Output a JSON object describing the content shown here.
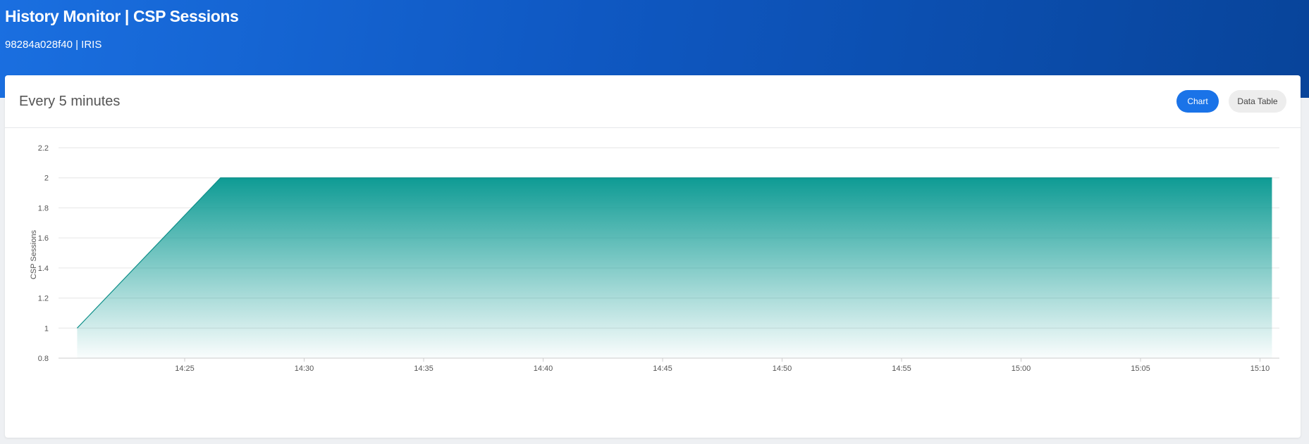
{
  "header": {
    "title": "History Monitor | CSP Sessions",
    "subtitle": "98284a028f40 | IRIS"
  },
  "card": {
    "title": "Every 5 minutes",
    "buttons": {
      "chart": "Chart",
      "data_table": "Data Table"
    }
  },
  "colors": {
    "header_gradient_start": "#1a6fe0",
    "header_gradient_end": "#08449a",
    "accent_button": "#1a73e8",
    "series_fill": "#0e9b94"
  },
  "chart_data": {
    "type": "area",
    "ylabel": "CSP Sessions",
    "ylim": [
      0.8,
      2.2
    ],
    "yticks": [
      "2.2",
      "2",
      "1.8",
      "1.6",
      "1.4",
      "1.2",
      "1",
      "0.8"
    ],
    "xticks": [
      "14:25",
      "14:30",
      "14:35",
      "14:40",
      "14:45",
      "14:50",
      "14:55",
      "15:00",
      "15:05",
      "15:10"
    ],
    "grid": true,
    "series": [
      {
        "x": [
          "14:20:30",
          "14:26:30",
          "15:10:30"
        ],
        "values": [
          1,
          2,
          2
        ]
      }
    ]
  }
}
